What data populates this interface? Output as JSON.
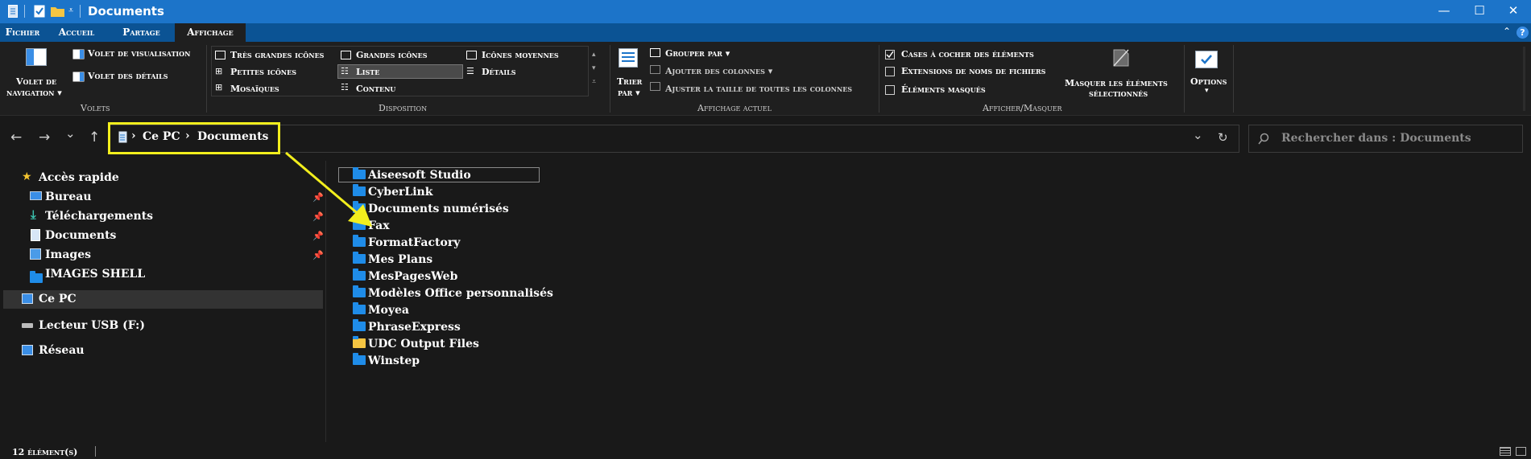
{
  "window": {
    "title": "Documents",
    "accent": "#1c74c9",
    "controls": {
      "minimize": "—",
      "maximize": "☐",
      "close": "✕"
    }
  },
  "ribbon_tabs": [
    {
      "label": "Fichier"
    },
    {
      "label": "Accueil"
    },
    {
      "label": "Partage"
    },
    {
      "label": "Affichage",
      "active": true
    }
  ],
  "ribbon": {
    "volets": {
      "group": "Volets",
      "nav_pane_line1": "Volet de",
      "nav_pane_line2": "navigation ▾",
      "preview": "Volet de visualisation",
      "details": "Volet des détails"
    },
    "disposition": {
      "group": "Disposition",
      "col1": [
        "Très grandes icônes",
        "Petites icônes",
        "Mosaïques"
      ],
      "col2": [
        "Grandes icônes",
        "Liste",
        "Contenu"
      ],
      "col3": [
        "Icônes moyennes",
        "Détails"
      ],
      "selected": "Liste"
    },
    "affichage_actuel": {
      "group": "Affichage actuel",
      "sort_line1": "Trier",
      "sort_line2": "par ▾",
      "group_by": "Grouper par ▾",
      "add_columns": "Ajouter des colonnes ▾",
      "fit_columns": "Ajuster la taille de toutes les colonnes"
    },
    "afficher_masquer": {
      "group": "Afficher/Masquer",
      "checkboxes": "Cases à cocher des éléments",
      "extensions": "Extensions de noms de fichiers",
      "hidden": "Éléments masqués",
      "hide_line1": "Masquer les éléments",
      "hide_line2": "sélectionnés",
      "checkboxes_checked": true,
      "extensions_checked": false,
      "hidden_checked": false
    },
    "options": {
      "label": "Options",
      "arrow": "▾"
    }
  },
  "navigation": {
    "back": "←",
    "forward": "→",
    "recent": "⌄",
    "up": "↑"
  },
  "address": {
    "crumbs": [
      "Ce PC",
      "Documents"
    ],
    "separator": "›",
    "dropdown": "⌄",
    "refresh": "↻",
    "highlight_color": "#f2ee1d"
  },
  "search": {
    "placeholder": "Rechercher dans : Documents"
  },
  "nav_pane": {
    "quick_access": "Accès rapide",
    "quick_items": [
      "Bureau",
      "Téléchargements",
      "Documents",
      "Images",
      "IMAGES SHELL"
    ],
    "this_pc": "Ce PC",
    "usb": "Lecteur USB (F:)",
    "network": "Réseau"
  },
  "files": [
    "Aiseesoft Studio",
    "CyberLink",
    "Documents numérisés",
    "Fax",
    "FormatFactory",
    "Mes Plans",
    "MesPagesWeb",
    "Modèles Office personnalisés",
    "Moyea",
    "PhraseExpress",
    "UDC Output Files",
    "Winstep"
  ],
  "status": {
    "count": "12 élément(s)"
  }
}
